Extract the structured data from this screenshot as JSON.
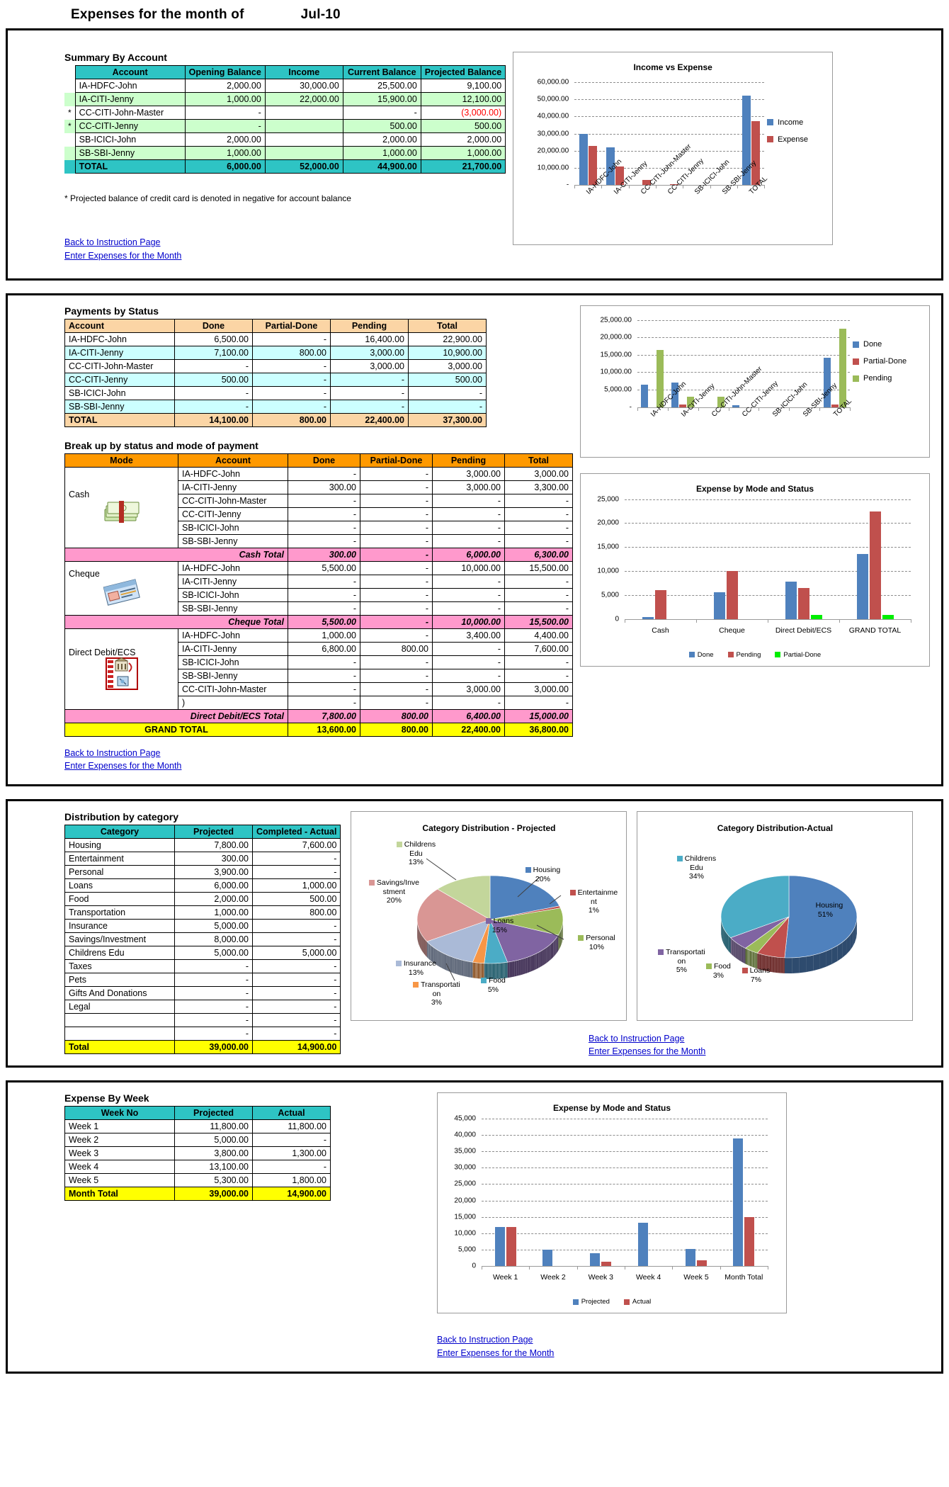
{
  "header": {
    "title": "Expenses for the month of",
    "month": "Jul-10"
  },
  "links": {
    "instruction": "Back to Instruction Page",
    "enter": "Enter Expenses for the Month"
  },
  "section1": {
    "table_title": "Summary By Account",
    "columns": [
      "Account",
      "Opening Balance",
      "Income",
      "Current Balance",
      "Projected Balance"
    ],
    "rows": [
      {
        "star": "",
        "account": "IA-HDFC-John",
        "opening": "2,000.00",
        "income": "30,000.00",
        "current": "25,500.00",
        "projected": "9,100.00",
        "neg": false
      },
      {
        "star": "",
        "account": "IA-CITI-Jenny",
        "opening": "1,000.00",
        "income": "22,000.00",
        "current": "15,900.00",
        "projected": "12,100.00",
        "neg": false
      },
      {
        "star": "*",
        "account": "CC-CITI-John-Master",
        "opening": "-",
        "income": "",
        "current": "-",
        "projected": "(3,000.00)",
        "neg": true
      },
      {
        "star": "*",
        "account": "CC-CITI-Jenny",
        "opening": "-",
        "income": "",
        "current": "500.00",
        "projected": "500.00",
        "neg": false
      },
      {
        "star": "",
        "account": "SB-ICICI-John",
        "opening": "2,000.00",
        "income": "",
        "current": "2,000.00",
        "projected": "2,000.00",
        "neg": false
      },
      {
        "star": "",
        "account": "SB-SBI-Jenny",
        "opening": "1,000.00",
        "income": "",
        "current": "1,000.00",
        "projected": "1,000.00",
        "neg": false
      }
    ],
    "total": {
      "label": "TOTAL",
      "opening": "6,000.00",
      "income": "52,000.00",
      "current": "44,900.00",
      "projected": "21,700.00"
    },
    "footnote": "* Projected balance of credit card is denoted in negative for account balance"
  },
  "section2": {
    "status_title": "Payments by Status",
    "status_columns": [
      "Account",
      "Done",
      "Partial-Done",
      "Pending",
      "Total"
    ],
    "status_rows": [
      {
        "account": "IA-HDFC-John",
        "done": "6,500.00",
        "partial": "-",
        "pending": "16,400.00",
        "total": "22,900.00"
      },
      {
        "account": "IA-CITI-Jenny",
        "done": "7,100.00",
        "partial": "800.00",
        "pending": "3,000.00",
        "total": "10,900.00"
      },
      {
        "account": "CC-CITI-John-Master",
        "done": "-",
        "partial": "-",
        "pending": "3,000.00",
        "total": "3,000.00"
      },
      {
        "account": "CC-CITI-Jenny",
        "done": "500.00",
        "partial": "-",
        "pending": "-",
        "total": "500.00"
      },
      {
        "account": "SB-ICICI-John",
        "done": "-",
        "partial": "-",
        "pending": "-",
        "total": "-"
      },
      {
        "account": "SB-SBI-Jenny",
        "done": "-",
        "partial": "-",
        "pending": "-",
        "total": "-"
      }
    ],
    "status_total": {
      "label": "TOTAL",
      "done": "14,100.00",
      "partial": "800.00",
      "pending": "22,400.00",
      "total": "37,300.00"
    },
    "mode_title": "Break up by status and mode of payment",
    "mode_columns": [
      "Mode",
      "Account",
      "Done",
      "Partial-Done",
      "Pending",
      "Total"
    ],
    "cash_label": "Cash",
    "cash_rows": [
      {
        "account": "IA-HDFC-John",
        "done": "-",
        "partial": "-",
        "pending": "3,000.00",
        "total": "3,000.00"
      },
      {
        "account": "IA-CITI-Jenny",
        "done": "300.00",
        "partial": "-",
        "pending": "3,000.00",
        "total": "3,300.00"
      },
      {
        "account": "CC-CITI-John-Master",
        "done": "-",
        "partial": "-",
        "pending": "-",
        "total": "-"
      },
      {
        "account": "CC-CITI-Jenny",
        "done": "-",
        "partial": "-",
        "pending": "-",
        "total": "-"
      },
      {
        "account": "SB-ICICI-John",
        "done": "-",
        "partial": "-",
        "pending": "-",
        "total": "-"
      },
      {
        "account": "SB-SBI-Jenny",
        "done": "-",
        "partial": "-",
        "pending": "-",
        "total": "-"
      }
    ],
    "cash_total": {
      "label": "Cash Total",
      "done": "300.00",
      "partial": "-",
      "pending": "6,000.00",
      "total": "6,300.00"
    },
    "cheque_label": "Cheque",
    "cheque_rows": [
      {
        "account": "IA-HDFC-John",
        "done": "5,500.00",
        "partial": "-",
        "pending": "10,000.00",
        "total": "15,500.00"
      },
      {
        "account": "IA-CITI-Jenny",
        "done": "-",
        "partial": "-",
        "pending": "-",
        "total": "-"
      },
      {
        "account": "SB-ICICI-John",
        "done": "-",
        "partial": "-",
        "pending": "-",
        "total": "-"
      },
      {
        "account": "SB-SBI-Jenny",
        "done": "-",
        "partial": "-",
        "pending": "-",
        "total": "-"
      }
    ],
    "cheque_total": {
      "label": "Cheque Total",
      "done": "5,500.00",
      "partial": "-",
      "pending": "10,000.00",
      "total": "15,500.00"
    },
    "ecs_label": "Direct Debit/ECS",
    "ecs_rows": [
      {
        "account": "IA-HDFC-John",
        "done": "1,000.00",
        "partial": "-",
        "pending": "3,400.00",
        "total": "4,400.00"
      },
      {
        "account": "IA-CITI-Jenny",
        "done": "6,800.00",
        "partial": "800.00",
        "pending": "-",
        "total": "7,600.00"
      },
      {
        "account": "SB-ICICI-John",
        "done": "-",
        "partial": "-",
        "pending": "-",
        "total": "-"
      },
      {
        "account": "SB-SBI-Jenny",
        "done": "-",
        "partial": "-",
        "pending": "-",
        "total": "-"
      },
      {
        "account": "CC-CITI-John-Master",
        "done": "-",
        "partial": "-",
        "pending": "3,000.00",
        "total": "3,000.00"
      },
      {
        "account": ")",
        "done": "-",
        "partial": "-",
        "pending": "-",
        "total": "-"
      }
    ],
    "ecs_total": {
      "label": "Direct Debit/ECS Total",
      "done": "7,800.00",
      "partial": "800.00",
      "pending": "6,400.00",
      "total": "15,000.00"
    },
    "grand_total": {
      "label": "GRAND TOTAL",
      "done": "13,600.00",
      "partial": "800.00",
      "pending": "22,400.00",
      "total": "36,800.00"
    }
  },
  "section3": {
    "table_title": "Distribution by category",
    "columns": [
      "Category",
      "Projected",
      "Completed - Actual"
    ],
    "rows": [
      {
        "category": "Housing",
        "projected": "7,800.00",
        "actual": "7,600.00"
      },
      {
        "category": "Entertainment",
        "projected": "300.00",
        "actual": "-"
      },
      {
        "category": "Personal",
        "projected": "3,900.00",
        "actual": "-"
      },
      {
        "category": "Loans",
        "projected": "6,000.00",
        "actual": "1,000.00"
      },
      {
        "category": "Food",
        "projected": "2,000.00",
        "actual": "500.00"
      },
      {
        "category": "Transportation",
        "projected": "1,000.00",
        "actual": "800.00"
      },
      {
        "category": "Insurance",
        "projected": "5,000.00",
        "actual": "-"
      },
      {
        "category": "Savings/Investment",
        "projected": "8,000.00",
        "actual": "-"
      },
      {
        "category": "Childrens Edu",
        "projected": "5,000.00",
        "actual": "5,000.00"
      },
      {
        "category": "Taxes",
        "projected": "-",
        "actual": "-"
      },
      {
        "category": "Pets",
        "projected": "-",
        "actual": "-"
      },
      {
        "category": "Gifts And Donations",
        "projected": "-",
        "actual": "-"
      },
      {
        "category": "Legal",
        "projected": "-",
        "actual": "-"
      },
      {
        "category": "",
        "projected": "-",
        "actual": "-"
      },
      {
        "category": "",
        "projected": "-",
        "actual": "-"
      }
    ],
    "total": {
      "label": "Total",
      "projected": "39,000.00",
      "actual": "14,900.00"
    }
  },
  "section4": {
    "table_title": "Expense By Week",
    "columns": [
      "Week No",
      "Projected",
      "Actual"
    ],
    "rows": [
      {
        "week": "Week 1",
        "projected": "11,800.00",
        "actual": "11,800.00"
      },
      {
        "week": "Week 2",
        "projected": "5,000.00",
        "actual": "-"
      },
      {
        "week": "Week 3",
        "projected": "3,800.00",
        "actual": "1,300.00"
      },
      {
        "week": "Week 4",
        "projected": "13,100.00",
        "actual": "-"
      },
      {
        "week": "Week 5",
        "projected": "5,300.00",
        "actual": "1,800.00"
      }
    ],
    "total": {
      "label": "Month Total",
      "projected": "39,000.00",
      "actual": "14,900.00"
    }
  },
  "colors": {
    "blue": "#4f81bd",
    "red": "#c0504d",
    "green": "#9bbb59",
    "bright_green": "#00ee00",
    "teal_header": "#2ec4c4",
    "orange_header": "#fbd5a5",
    "orange_dark": "#ff9900",
    "pink": "#ff99cc",
    "yellow": "#ffff00",
    "lightgreen": "#ccffcc",
    "lightcyan": "#ccffff"
  },
  "chart_data": [
    {
      "id": "income_vs_expense",
      "type": "bar",
      "title": "Income vs Expense",
      "categories": [
        "IA-HDFC-John",
        "IA-CITI-Jenny",
        "CC-CITI-John-Master",
        "CC-CITI-Jenny",
        "SB-ICICI-John",
        "SB-SBI-Jenny",
        "TOTAL"
      ],
      "series": [
        {
          "name": "Income",
          "color": "#4f81bd",
          "values": [
            30000,
            22000,
            0,
            0,
            0,
            0,
            52000
          ]
        },
        {
          "name": "Expense",
          "color": "#c0504d",
          "values": [
            22900,
            10900,
            3000,
            500,
            0,
            0,
            37300
          ]
        }
      ],
      "ytick_labels": [
        "60,000.00",
        "50,000.00",
        "40,000.00",
        "30,000.00",
        "20,000.00",
        "10,000.00",
        "-"
      ],
      "ylim": [
        0,
        60000
      ],
      "grid": true,
      "legend_position": "right"
    },
    {
      "id": "payments_by_status",
      "type": "bar",
      "title": "",
      "categories": [
        "IA-HDFC-John",
        "IA-CITI-Jenny",
        "CC-CITI-John-Master",
        "CC-CITI-Jenny",
        "SB-ICICI-John",
        "SB-SBI-Jenny",
        "TOTAL"
      ],
      "series": [
        {
          "name": "Done",
          "color": "#4f81bd",
          "values": [
            6500,
            7100,
            0,
            500,
            0,
            0,
            14100
          ]
        },
        {
          "name": "Partial-Done",
          "color": "#c0504d",
          "values": [
            0,
            800,
            0,
            0,
            0,
            0,
            800
          ]
        },
        {
          "name": "Pending",
          "color": "#9bbb59",
          "values": [
            16400,
            3000,
            3000,
            0,
            0,
            0,
            22400
          ]
        }
      ],
      "ytick_labels": [
        "25,000.00",
        "20,000.00",
        "15,000.00",
        "10,000.00",
        "5,000.00",
        "-"
      ],
      "ylim": [
        0,
        25000
      ],
      "grid": true,
      "legend_position": "right"
    },
    {
      "id": "expense_by_mode_and_status",
      "type": "bar",
      "title": "Expense by Mode and Status",
      "categories": [
        "Cash",
        "Cheque",
        "Direct Debit/ECS",
        "GRAND TOTAL"
      ],
      "series": [
        {
          "name": "Done",
          "color": "#4f81bd",
          "values": [
            300,
            5500,
            7800,
            13600
          ]
        },
        {
          "name": "Pending",
          "color": "#c0504d",
          "values": [
            6000,
            10000,
            6400,
            22400
          ]
        },
        {
          "name": "Partial-Done",
          "color": "#00ee00",
          "values": [
            0,
            0,
            800,
            800
          ]
        }
      ],
      "ytick_labels": [
        "25,000",
        "20,000",
        "15,000",
        "10,000",
        "5,000",
        "0"
      ],
      "ylim": [
        0,
        25000
      ],
      "grid": true,
      "legend_position": "bottom"
    },
    {
      "id": "category_distribution_projected",
      "type": "pie",
      "title": "Category Distribution - Projected",
      "labels": [
        "Housing",
        "Entertainment",
        "Personal",
        "Loans",
        "Food",
        "Transportation",
        "Insurance",
        "Savings/Investment",
        "Childrens Edu"
      ],
      "percent_labels": [
        "20%",
        "1%",
        "10%",
        "15%",
        "5%",
        "3%",
        "13%",
        "20%",
        "13%"
      ],
      "values": [
        7800,
        300,
        3900,
        6000,
        2000,
        1000,
        5000,
        8000,
        5000
      ],
      "colors": [
        "#4f81bd",
        "#c0504d",
        "#9bbb59",
        "#8064a2",
        "#4bacc6",
        "#f79646",
        "#aabad7",
        "#d99694",
        "#c3d69b"
      ]
    },
    {
      "id": "category_distribution_actual",
      "type": "pie",
      "title": "Category Distribution-Actual",
      "labels": [
        "Housing",
        "Loans",
        "Food",
        "Transportation",
        "Childrens Edu"
      ],
      "percent_labels": [
        "51%",
        "7%",
        "3%",
        "5%",
        "34%"
      ],
      "values": [
        7600,
        1000,
        500,
        800,
        5000
      ],
      "colors": [
        "#4f81bd",
        "#c0504d",
        "#9bbb59",
        "#8064a2",
        "#4bacc6"
      ]
    },
    {
      "id": "expense_by_week",
      "type": "bar",
      "title": "Expense by Mode and Status",
      "categories": [
        "Week 1",
        "Week 2",
        "Week 3",
        "Week 4",
        "Week 5",
        "Month Total"
      ],
      "series": [
        {
          "name": "Projected",
          "color": "#4f81bd",
          "values": [
            11800,
            5000,
            3800,
            13100,
            5300,
            39000
          ]
        },
        {
          "name": "Actual",
          "color": "#c0504d",
          "values": [
            11800,
            0,
            1300,
            0,
            1800,
            14900
          ]
        }
      ],
      "ytick_labels": [
        "45,000",
        "40,000",
        "35,000",
        "30,000",
        "25,000",
        "20,000",
        "15,000",
        "10,000",
        "5,000",
        "0"
      ],
      "ylim": [
        0,
        45000
      ],
      "grid": true,
      "legend_position": "bottom"
    }
  ]
}
